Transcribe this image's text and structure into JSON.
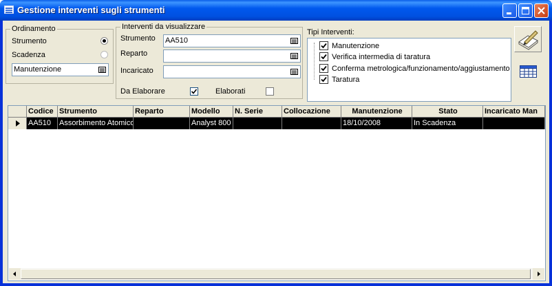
{
  "window": {
    "title": "Gestione interventi sugli strumenti",
    "controls": {
      "minimize": "minimize-icon",
      "maximize": "maximize-icon",
      "close": "close-icon"
    }
  },
  "ordinamento": {
    "title": "Ordinamento",
    "options": [
      {
        "label": "Strumento",
        "selected": true
      },
      {
        "label": "Scadenza",
        "selected": false
      }
    ],
    "combo_value": "Manutenzione"
  },
  "interventi": {
    "title": "Interventi da visualizzare",
    "strumento": {
      "label": "Strumento",
      "value": "AA510"
    },
    "reparto": {
      "label": "Reparto",
      "value": ""
    },
    "incaricato": {
      "label": "Incaricato",
      "value": ""
    },
    "da_elaborare": {
      "label": "Da Elaborare",
      "checked": true
    },
    "elaborati": {
      "label": "Elaborati",
      "checked": false
    }
  },
  "tipi": {
    "title": "Tipi Interventi:",
    "items": [
      {
        "label": "Manutenzione",
        "checked": true
      },
      {
        "label": "Verifica intermedia di taratura",
        "checked": true
      },
      {
        "label": "Conferma metrologica/funzionamento/aggiustamento",
        "checked": true
      },
      {
        "label": "Taratura",
        "checked": true
      }
    ]
  },
  "toolbar": {
    "edit_icon": "edit-pen-icon",
    "table_icon": "table-grid-icon"
  },
  "grid": {
    "columns": [
      "Codice",
      "Strumento",
      "Reparto",
      "Modello",
      "N. Serie",
      "Collocazione",
      "Manutenzione",
      "Stato",
      "Incaricato Man"
    ],
    "rows": [
      [
        "AA510",
        "Assorbimento Atomico",
        "",
        "Analyst 800",
        "",
        "",
        "18/10/2008",
        "In Scadenza",
        ""
      ]
    ]
  },
  "colors": {
    "selected_row": "#000000",
    "window_frame": "#0831d9",
    "dialog_bg": "#ece9d8"
  }
}
